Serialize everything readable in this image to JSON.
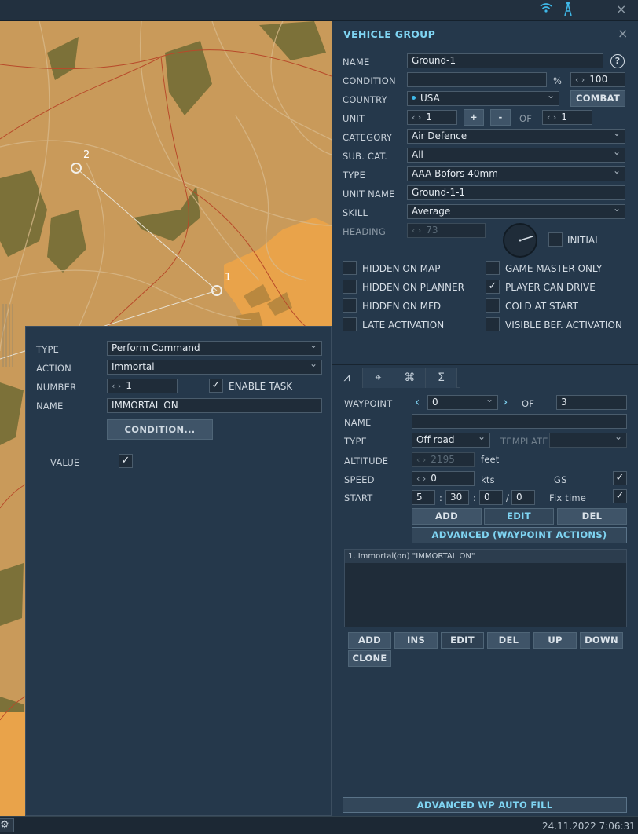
{
  "topbar": {
    "wifi_icon": "wifi-icon",
    "signal_icon": "signal-tower-icon",
    "close": "×"
  },
  "colors": {
    "accent": "#7fd4f2",
    "panel": "#25384b",
    "map": "#c99a5a"
  },
  "map": {
    "wp1": "1",
    "wp2": "2"
  },
  "vehicle_group": {
    "title": "VEHICLE GROUP",
    "close": "×",
    "name_label": "NAME",
    "name_value": "Ground-1",
    "help": "?",
    "condition_label": "CONDITION",
    "condition_value": "",
    "percent": "%",
    "probability": "100",
    "country_label": "COUNTRY",
    "country_value": "USA",
    "combat": "COMBAT",
    "unit_label": "UNIT",
    "unit_value": "1",
    "plus": "+",
    "minus": "-",
    "of": "OF",
    "unit_total": "1",
    "category_label": "CATEGORY",
    "category_value": "Air Defence",
    "subcat_label": "SUB. CAT.",
    "subcat_value": "All",
    "type_label": "TYPE",
    "type_value": "AAA Bofors 40mm",
    "unit_name_label": "UNIT NAME",
    "unit_name_value": "Ground-1-1",
    "skill_label": "SKILL",
    "skill_value": "Average",
    "heading_label": "HEADING",
    "heading_value": "73",
    "initial": "INITIAL",
    "checks": [
      {
        "label": "HIDDEN ON MAP",
        "checked": false
      },
      {
        "label": "HIDDEN ON PLANNER",
        "checked": false
      },
      {
        "label": "HIDDEN ON MFD",
        "checked": false
      },
      {
        "label": "LATE ACTIVATION",
        "checked": false
      },
      {
        "label": "GAME MASTER ONLY",
        "checked": false
      },
      {
        "label": "PLAYER CAN DRIVE",
        "checked": true
      },
      {
        "label": "COLD AT START",
        "checked": false
      },
      {
        "label": "VISIBLE BEF. ACTIVATION",
        "checked": false
      }
    ]
  },
  "route": {
    "tabs": [
      "route-icon",
      "target-icon",
      "command-icon",
      "sum-icon"
    ],
    "waypoint_label": "WAYPOINT",
    "waypoint_value": "0",
    "of": "OF",
    "waypoint_total": "3",
    "name_label": "NAME",
    "name_value": "",
    "type_label": "TYPE",
    "type_value": "Off road",
    "template_label": "TEMPLATE",
    "template_value": "",
    "altitude_label": "ALTITUDE",
    "altitude_value": "2195",
    "altitude_unit": "feet",
    "speed_label": "SPEED",
    "speed_value": "0",
    "speed_unit": "kts",
    "gs": "GS",
    "start_label": "START",
    "start_d": "5",
    "start_h": "30",
    "start_m": "0",
    "start_s": "0",
    "sep1": ":",
    "sep2": ":",
    "sep3": "/",
    "fix_time": "Fix time",
    "add": "ADD",
    "edit": "EDIT",
    "del": "DEL",
    "advanced": "ADVANCED (WAYPOINT ACTIONS)",
    "actions": [
      "1. Immortal(on) \"IMMORTAL ON\""
    ],
    "btn_add": "ADD",
    "btn_ins": "INS",
    "btn_edit": "EDIT",
    "btn_del": "DEL",
    "btn_up": "UP",
    "btn_down": "DOWN",
    "btn_clone": "CLONE",
    "auto_fill": "ADVANCED WP AUTO FILL"
  },
  "task": {
    "type_label": "TYPE",
    "type_value": "Perform Command",
    "action_label": "ACTION",
    "action_value": "Immortal",
    "number_label": "NUMBER",
    "number_value": "1",
    "enable_task": "ENABLE TASK",
    "name_label": "NAME",
    "name_value": "IMMORTAL ON",
    "condition_btn": "CONDITION...",
    "value_label": "VALUE"
  },
  "status": {
    "datetime": "24.11.2022 7:06:31"
  }
}
